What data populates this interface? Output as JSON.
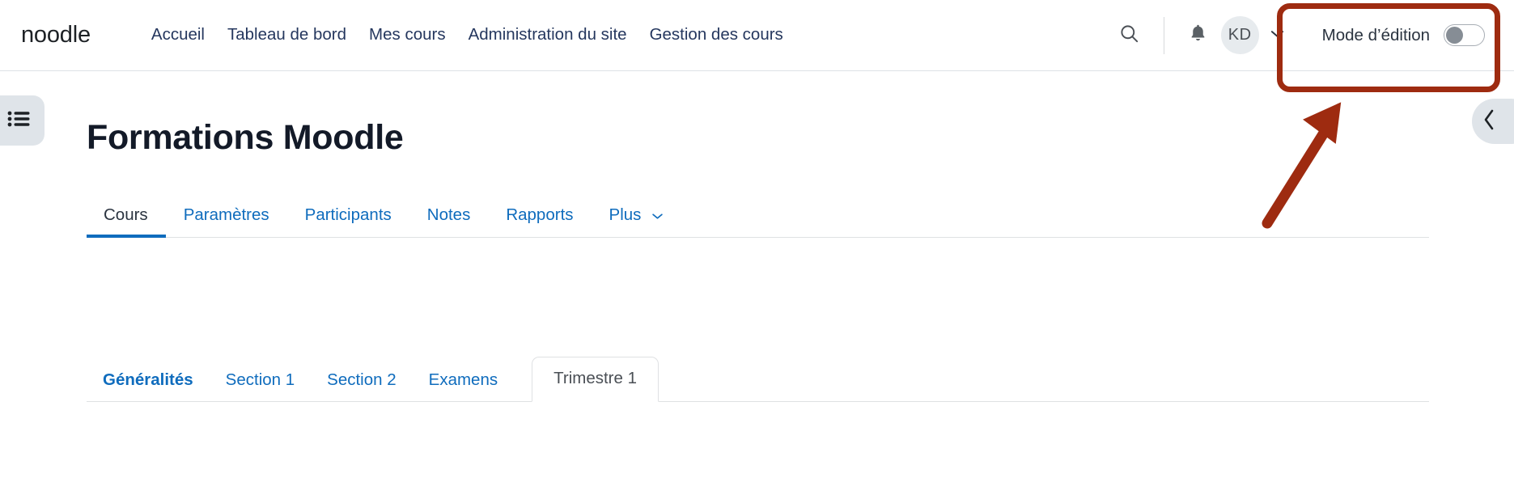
{
  "header": {
    "brand": "noodle",
    "nav_items": [
      {
        "label": "Accueil"
      },
      {
        "label": "Tableau de bord"
      },
      {
        "label": "Mes cours"
      },
      {
        "label": "Administration du site"
      },
      {
        "label": "Gestion des cours"
      }
    ],
    "search_icon": "search-icon",
    "notifications_icon": "bell-icon",
    "avatar_initials": "KD",
    "avatar_caret": "⌄",
    "edit_mode": {
      "label": "Mode d’édition",
      "state": "off"
    }
  },
  "drawers": {
    "left_toggle_icon": "course-index-list-icon",
    "right_toggle_icon": "chevron-left-icon",
    "right_toggle_glyph": "‹"
  },
  "main": {
    "page_title": "Formations Moodle",
    "tabs": [
      {
        "label": "Cours",
        "active": true
      },
      {
        "label": "Paramètres",
        "active": false
      },
      {
        "label": "Participants",
        "active": false
      },
      {
        "label": "Notes",
        "active": false
      },
      {
        "label": "Rapports",
        "active": false
      },
      {
        "label": "Plus",
        "active": false,
        "caret": "⌄"
      }
    ],
    "section_tabs": [
      {
        "label": "Généralités",
        "style": "bold-link"
      },
      {
        "label": "Section 1",
        "style": "link"
      },
      {
        "label": "Section 2",
        "style": "link"
      },
      {
        "label": "Examens",
        "style": "link"
      },
      {
        "label": "Trimestre 1",
        "style": "current"
      }
    ]
  },
  "annotations": {
    "highlight_box": {
      "target": "Mode d’édition",
      "color": "#9e2b10"
    },
    "arrow": {
      "direction": "up-right",
      "color": "#9e2b10"
    }
  },
  "colors": {
    "link_blue": "#0f6cbd",
    "text_dark": "#2b3440",
    "title_dark": "#131a28",
    "border_gray": "#dfe1e3",
    "drawer_gray": "#dfe4e9",
    "annotation_red": "#9e2b10"
  }
}
